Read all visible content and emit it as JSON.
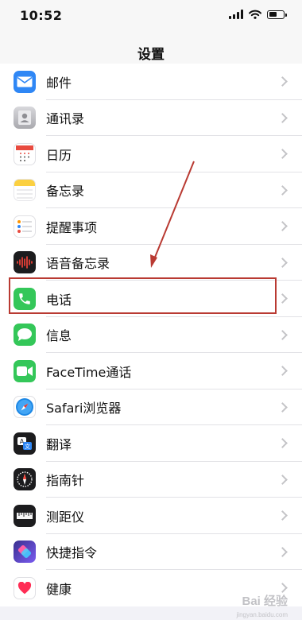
{
  "status_bar": {
    "time": "10:52"
  },
  "nav": {
    "title": "设置"
  },
  "items": [
    {
      "label": "邮件",
      "icon": "mail-icon",
      "color": "#2f87f5"
    },
    {
      "label": "通讯录",
      "icon": "contacts-icon",
      "color": "#9b9b9f"
    },
    {
      "label": "日历",
      "icon": "calendar-icon",
      "color": "#ffffff"
    },
    {
      "label": "备忘录",
      "icon": "notes-icon",
      "color": "#fbd041"
    },
    {
      "label": "提醒事项",
      "icon": "reminders-icon",
      "color": "#ffffff"
    },
    {
      "label": "语音备忘录",
      "icon": "voice-memos-icon",
      "color": "#1c1c1e"
    },
    {
      "label": "电话",
      "icon": "phone-icon",
      "color": "#34c759"
    },
    {
      "label": "信息",
      "icon": "messages-icon",
      "color": "#34c759"
    },
    {
      "label": "FaceTime通话",
      "icon": "facetime-icon",
      "color": "#34c759"
    },
    {
      "label": "Safari浏览器",
      "icon": "safari-icon",
      "color": "#1e88e5"
    },
    {
      "label": "翻译",
      "icon": "translate-icon",
      "color": "#1c1c1e"
    },
    {
      "label": "指南针",
      "icon": "compass-icon",
      "color": "#1c1c1e"
    },
    {
      "label": "测距仪",
      "icon": "measure-icon",
      "color": "#1c1c1e"
    },
    {
      "label": "快捷指令",
      "icon": "shortcuts-icon",
      "color": "#5a4fcf"
    },
    {
      "label": "健康",
      "icon": "health-icon",
      "color": "#ffffff"
    }
  ],
  "annotation": {
    "color": "#b93a32",
    "highlighted_item": "电话"
  },
  "watermark": {
    "text": "Bai 经验",
    "sub": "jingyan.baidu.com"
  }
}
